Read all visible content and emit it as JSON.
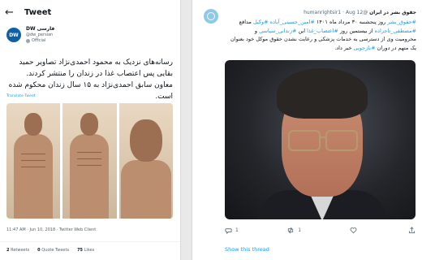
{
  "left": {
    "title": "Tweet",
    "name": "DW فارسی",
    "handle": "@dw_persian",
    "badge": "Official",
    "text": "رسانه‌های نزدیک به محمود احمدی‌نژاد تصاویر حمید بقایی پس اعتصاب غذا در زندان را منتشر کردند. معاون سابق احمدی‌نژاد به ۱۵ سال زندان محکوم شده است.",
    "translate": "Translate Tweet",
    "meta": "11:47 AM · Jun 10, 2018 · Twitter Web Client",
    "stats": {
      "retweets": "2",
      "retweets_label": "Retweets",
      "quotes": "0",
      "quotes_label": "Quote Tweets",
      "likes": "75",
      "likes_label": "Likes"
    }
  },
  "right": {
    "name": "حقوق بشر در ایران",
    "handle": "@humanrightsir1",
    "date": "Aug 12",
    "line1_tags": "#حقوق_بشر",
    "line1_text": " روز پنجشنبه ۳۰ مرداد ماه ۱۴۰۱ ",
    "line1_tag2": "#امین_حسینی_آباده",
    "line1_tag3": " #وکیل",
    "line1_end": " مدافع",
    "line2_tag": "#مصطفی_تاجزاده",
    "line2_text": " از بیستمین روز ",
    "line2_tag2": "#اعتصاب_غذا",
    "line2_text2": " این ",
    "line2_tag3": "#زندانی_سیاسی",
    "line2_end": " و",
    "line3": "محرومیت وی از دسترسی به خدمات پزشکی و رعایت نشدن حقوق موکل خود بعنوان",
    "line4_a": "یک متهم در دوران ",
    "line4_tag": "#بازجویی",
    "line4_b": " خبر داد.",
    "icons": {
      "reply": "1",
      "retweet": "1",
      "like": "",
      "share": ""
    },
    "show": "Show this thread"
  }
}
